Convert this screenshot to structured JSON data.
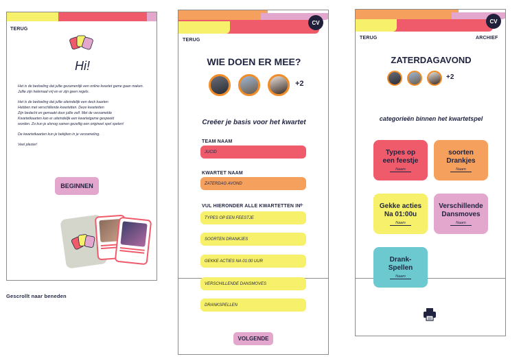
{
  "colors": {
    "pink": "#ef5b6b",
    "orange": "#f6a05e",
    "yellow": "#f7f06a",
    "lilac": "#e3a6cd",
    "teal": "#6cc9cf",
    "navy": "#1f2340"
  },
  "screen1": {
    "back": "TERUG",
    "greeting": "Hi!",
    "paragraph1": "Het is de bedoeling dat jullie gezamenlijk een online kwartet game gaan maken. Jullie zijn helemaal vrij en er zijn geen regels.",
    "paragraph2": [
      "Het is de bedoeling dat jullie uiteindelijk een deck kaarten",
      "Hebben met verschillende kwartetten. Deze kwartetten",
      "Zijn bedacht en gemaakt door jullie zelf. Met de verzamelde",
      "Kwartetkaarten kan er uiteindelijk een kwartetgame gespeeld",
      "worden. Zo kun je alsnog samen gezellig een origineel spel spelen!"
    ],
    "paragraph3": "De kwartetkaarten kun je bekijken in je verzameling.",
    "paragraph4": "Veel plezier!",
    "button": "BEGINNEN",
    "caption": "Gescrollt naar beneden"
  },
  "screen2": {
    "back": "TERUG",
    "avatar": "CV",
    "title": "WIE DOEN ER MEE?",
    "more": "+2",
    "subtitle": "Creëer je basis voor het kwartet",
    "team_label": "TEAM NAAM",
    "team_value": "JUCID",
    "kwartet_label": "KWARTET NAAM",
    "kwartet_value": "ZATERDAG AVOND",
    "fill_label": "VUL HIERONDER ALLE KWARTETTEN IN",
    "plus": "+",
    "items": [
      "TYPES OP EEN FEESTJE",
      "SOORTEN DRANKJES",
      "GEKKE ACTIES NA 01:00 UUR",
      "VERSCHILLENDE DANSMOVES",
      "DRANKSPELLEN"
    ],
    "button": "VOLGENDE"
  },
  "screen3": {
    "back": "TERUG",
    "archive": "ARCHIEF",
    "avatar": "CV",
    "title": "ZATERDAGAVOND",
    "more": "+2",
    "subtitle": "categorieën binnen het kwartetspel",
    "tiles": [
      {
        "title": "Types op een feestje",
        "name": "Naam"
      },
      {
        "title": "soorten Drankjes",
        "name": "Naam"
      },
      {
        "title": "Gekke acties Na 01:00u",
        "name": "Naam"
      },
      {
        "title": "Verschillende Dansmoves",
        "name": "Naam"
      },
      {
        "title": "Drank-Spellen",
        "name": "Naam"
      }
    ],
    "print_icon": "printer-icon"
  }
}
